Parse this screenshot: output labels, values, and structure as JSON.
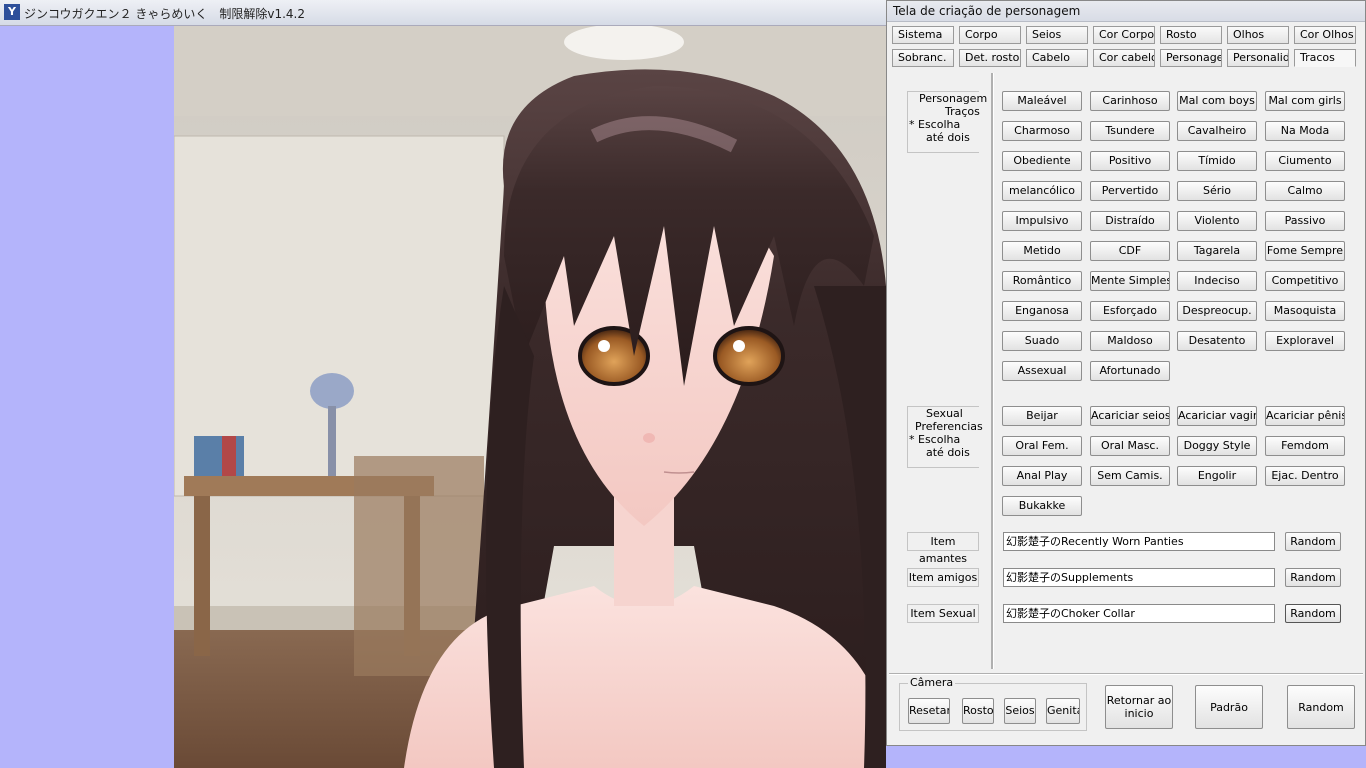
{
  "game_window": {
    "title": "ジンコウガクエン２ きゃらめいく　制限解除v1.4.2"
  },
  "panel": {
    "title": "Tela de criação de personagem",
    "tabs_row1": [
      "Sistema",
      "Corpo",
      "Seios",
      "Cor Corpo",
      "Rosto",
      "Olhos",
      "Cor Olhos"
    ],
    "tabs_row2": [
      "Sobranc.",
      "Det. rosto",
      "Cabelo",
      "Cor cabelo",
      "Personagen",
      "Personalid.",
      "Tracos"
    ],
    "active_tab": "Tracos",
    "traits_group": {
      "label_lines": [
        "Personagem",
        "Traços",
        "* Escolha",
        "até dois"
      ],
      "buttons": [
        "Maleável",
        "Carinhoso",
        "Mal com boys",
        "Mal com girls",
        "Charmoso",
        "Tsundere",
        "Cavalheiro",
        "Na Moda",
        "Obediente",
        "Positivo",
        "Tímido",
        "Ciumento",
        "melancólico",
        "Pervertido",
        "Sério",
        "Calmo",
        "Impulsivo",
        "Distraído",
        "Violento",
        "Passivo",
        "Metido",
        "CDF",
        "Tagarela",
        "Fome Sempre",
        "Romântico",
        "Mente Simples",
        "Indeciso",
        "Competitivo",
        "Enganosa",
        "Esforçado",
        "Despreocup.",
        "Masoquista",
        "Suado",
        "Maldoso",
        "Desatento",
        "Exploravel",
        "Assexual",
        "Afortunado"
      ]
    },
    "sexual_group": {
      "label_lines": [
        "Sexual",
        "Preferencias",
        "* Escolha",
        "até dois"
      ],
      "buttons": [
        "Beijar",
        "Acariciar seios",
        "Acariciar vagina",
        "Acariciar pênis",
        "Oral Fem.",
        "Oral Masc.",
        "Doggy Style",
        "Femdom",
        "Anal Play",
        "Sem Camis.",
        "Engolir",
        "Ejac. Dentro",
        "Bukakke"
      ]
    },
    "items": [
      {
        "label": "Item amantes",
        "value": "幻影楚子のRecently Worn Panties",
        "button": "Random"
      },
      {
        "label": "Item amigos",
        "value": "幻影楚子のSupplements",
        "button": "Random"
      },
      {
        "label": "Item Sexual",
        "value": "幻影楚子のChoker Collar",
        "button": "Random"
      }
    ],
    "camera": {
      "legend": "Câmera",
      "buttons": [
        "Resetar",
        "Rosto",
        "Seios",
        "Genita"
      ]
    },
    "bottom_buttons": {
      "back": "Retornar ao inicio",
      "default": "Padrão",
      "random": "Random"
    }
  },
  "colors": {
    "side_bar": "#b4b4fb",
    "panel_bg": "#f0f0f0",
    "hair": "#3b2a2a",
    "eyes": "#a0622a"
  }
}
